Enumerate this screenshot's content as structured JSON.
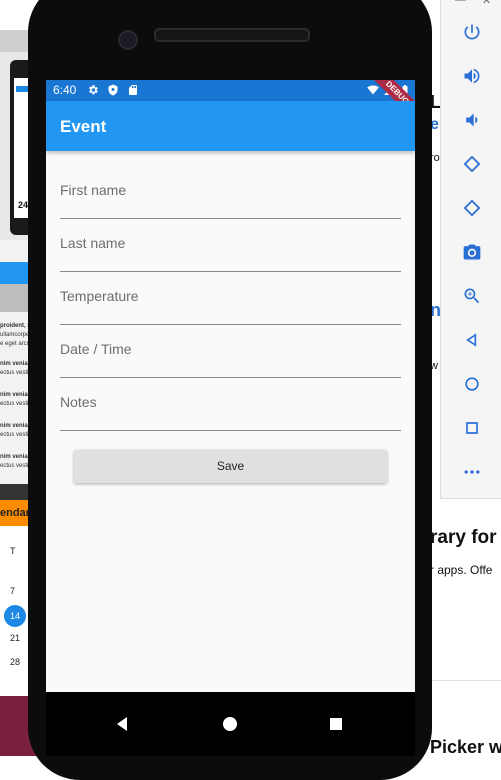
{
  "background": {
    "left_snippets": [
      "proident, s",
      "ullamcorpe",
      "e eget arcu",
      "nim venia",
      "ectus vesti",
      "nim venia",
      "ectus vesti",
      "nim venia",
      "ectus vesti",
      "nim venia",
      "ectus vesti"
    ],
    "left_banner": "endarn",
    "left_calendar": {
      "weekday": "T",
      "days": [
        "7",
        "14",
        "21",
        "28"
      ],
      "selected": "14"
    },
    "left_phone_date": "24",
    "right_fragments": [
      "Li",
      "e",
      "ro",
      "n",
      "w",
      "rary for",
      "r apps. Offe",
      "Picker w"
    ]
  },
  "emulator_toolbar": {
    "icons": [
      "power-icon",
      "volume-up-icon",
      "volume-down-icon",
      "rotate-left-icon",
      "rotate-right-icon",
      "camera-icon",
      "zoom-icon",
      "back-icon",
      "home-icon",
      "overview-icon",
      "more-icon"
    ]
  },
  "status_bar": {
    "time": "6:40",
    "debug_banner": "DEBUG"
  },
  "app_bar": {
    "title": "Event"
  },
  "form": {
    "fields": [
      {
        "label": "First name",
        "value": ""
      },
      {
        "label": "Last name",
        "value": ""
      },
      {
        "label": "Temperature",
        "value": ""
      },
      {
        "label": "Date / Time",
        "value": ""
      },
      {
        "label": "Notes",
        "value": ""
      }
    ],
    "save_label": "Save"
  },
  "colors": {
    "app_bar": "#2196f3",
    "status_bar": "#1976d2",
    "debug_banner": "#ad2b44",
    "button": "#e0e0e0",
    "toolbar_icon": "#2a6fd6"
  }
}
